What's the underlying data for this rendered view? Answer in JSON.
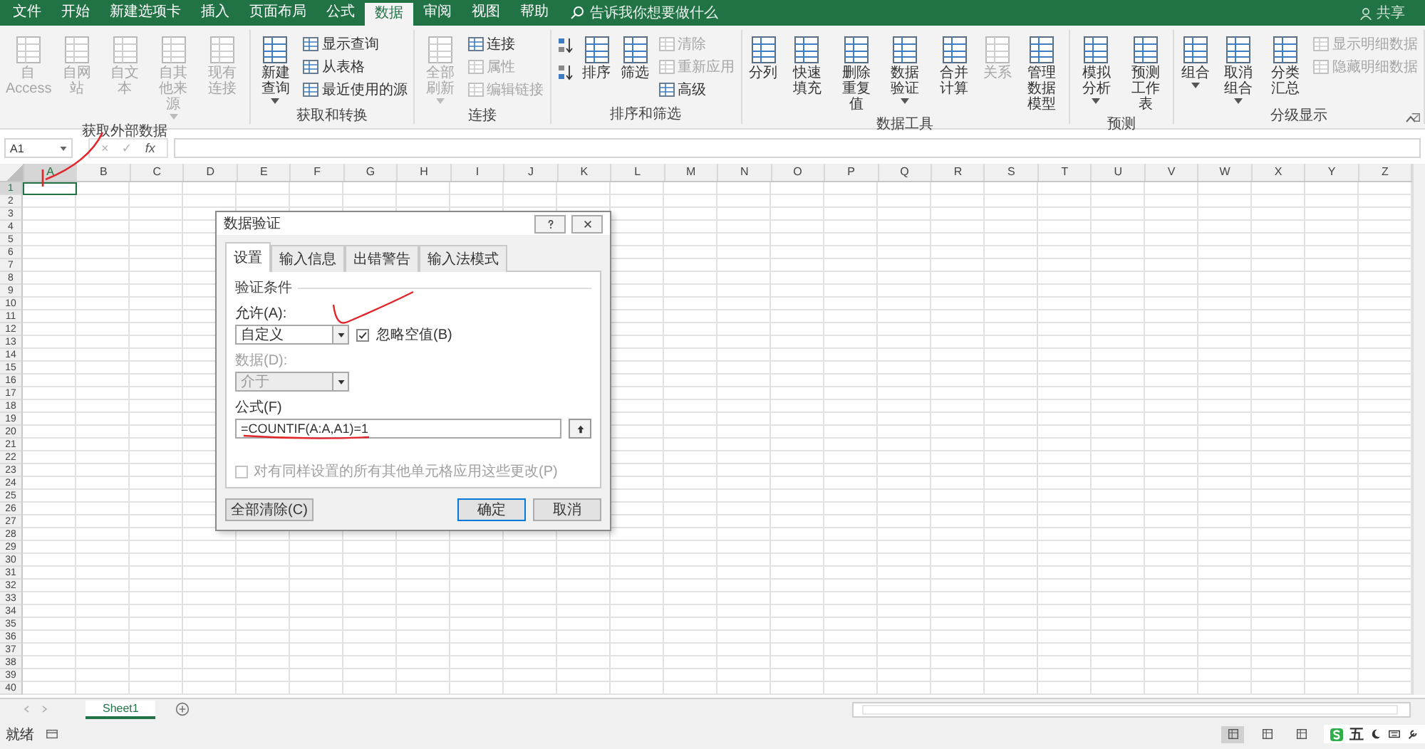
{
  "tabs": [
    {
      "label": "文件",
      "selected": false
    },
    {
      "label": "开始",
      "selected": false
    },
    {
      "label": "新建选项卡",
      "selected": false
    },
    {
      "label": "插入",
      "selected": false
    },
    {
      "label": "页面布局",
      "selected": false
    },
    {
      "label": "公式",
      "selected": false
    },
    {
      "label": "数据",
      "selected": true
    },
    {
      "label": "审阅",
      "selected": false
    },
    {
      "label": "视图",
      "selected": false
    },
    {
      "label": "帮助",
      "selected": false
    }
  ],
  "search": {
    "placeholder": "告诉我你想要做什么"
  },
  "share": "共享",
  "ribbon": [
    {
      "label": "获取外部数据",
      "launcher": false,
      "items": [
        {
          "kind": "large",
          "label": "自 Access",
          "disabled": true,
          "caret": false
        },
        {
          "kind": "large",
          "label": "自网站",
          "disabled": true,
          "caret": false
        },
        {
          "kind": "large",
          "label": "自文本",
          "disabled": true,
          "caret": false
        },
        {
          "kind": "large",
          "label": "自其他来源",
          "disabled": true,
          "caret": true
        },
        {
          "kind": "large",
          "label": "现有连接",
          "disabled": true,
          "caret": false
        }
      ]
    },
    {
      "label": "获取和转换",
      "launcher": false,
      "items": [
        {
          "kind": "large",
          "label": "新建查询",
          "disabled": false,
          "caret": true
        },
        {
          "kind": "small",
          "label": "显示查询",
          "disabled": false
        },
        {
          "kind": "small",
          "label": "从表格",
          "disabled": false
        },
        {
          "kind": "small",
          "label": "最近使用的源",
          "disabled": false
        }
      ]
    },
    {
      "label": "连接",
      "launcher": false,
      "items": [
        {
          "kind": "large",
          "label": "全部刷新",
          "disabled": true,
          "caret": true
        },
        {
          "kind": "small",
          "label": "连接",
          "disabled": false
        },
        {
          "kind": "small",
          "label": "属性",
          "disabled": true
        },
        {
          "kind": "small",
          "label": "编辑链接",
          "disabled": true
        }
      ]
    },
    {
      "label": "排序和筛选",
      "launcher": false,
      "items": [
        {
          "kind": "sort-asc",
          "disabled": false
        },
        {
          "kind": "sort-desc",
          "disabled": false
        },
        {
          "kind": "large",
          "label": "排序",
          "disabled": false,
          "caret": false
        },
        {
          "kind": "large",
          "label": "筛选",
          "disabled": false,
          "caret": false
        },
        {
          "kind": "small",
          "label": "清除",
          "disabled": true
        },
        {
          "kind": "small",
          "label": "重新应用",
          "disabled": true
        },
        {
          "kind": "small",
          "label": "高级",
          "disabled": false
        }
      ]
    },
    {
      "label": "数据工具",
      "launcher": false,
      "items": [
        {
          "kind": "large",
          "label": "分列",
          "disabled": false,
          "caret": false
        },
        {
          "kind": "large",
          "label": "快速填充",
          "disabled": false,
          "caret": false
        },
        {
          "kind": "large",
          "label": "删除重复值",
          "disabled": false,
          "caret": false
        },
        {
          "kind": "large",
          "label": "数据验证",
          "disabled": false,
          "caret": true
        },
        {
          "kind": "large",
          "label": "合并计算",
          "disabled": false,
          "caret": false
        },
        {
          "kind": "large",
          "label": "关系",
          "disabled": true,
          "caret": false
        },
        {
          "kind": "large",
          "label": "管理数据模型",
          "disabled": false,
          "caret": false
        }
      ]
    },
    {
      "label": "预测",
      "launcher": false,
      "items": [
        {
          "kind": "large",
          "label": "模拟分析",
          "disabled": false,
          "caret": true
        },
        {
          "kind": "large",
          "label": "预测工作表",
          "disabled": false,
          "caret": false
        }
      ]
    },
    {
      "label": "分级显示",
      "launcher": true,
      "items": [
        {
          "kind": "large",
          "label": "组合",
          "disabled": false,
          "caret": true
        },
        {
          "kind": "large",
          "label": "取消组合",
          "disabled": false,
          "caret": true
        },
        {
          "kind": "large",
          "label": "分类汇总",
          "disabled": false,
          "caret": false
        },
        {
          "kind": "small",
          "label": "显示明细数据",
          "disabled": true
        },
        {
          "kind": "small",
          "label": "隐藏明细数据",
          "disabled": true
        }
      ]
    }
  ],
  "formula_bar": {
    "name_box": "A1",
    "cancel": "×",
    "enter": "✓",
    "fx": "fx"
  },
  "columns": [
    {
      "label": "A",
      "selected": true
    },
    {
      "label": "B",
      "selected": false
    },
    {
      "label": "C",
      "selected": false
    },
    {
      "label": "D",
      "selected": false
    },
    {
      "label": "E",
      "selected": false
    },
    {
      "label": "F",
      "selected": false
    },
    {
      "label": "G",
      "selected": false
    },
    {
      "label": "H",
      "selected": false
    },
    {
      "label": "I",
      "selected": false
    },
    {
      "label": "J",
      "selected": false
    },
    {
      "label": "K",
      "selected": false
    },
    {
      "label": "L",
      "selected": false
    },
    {
      "label": "M",
      "selected": false
    },
    {
      "label": "N",
      "selected": false
    },
    {
      "label": "O",
      "selected": false
    },
    {
      "label": "P",
      "selected": false
    },
    {
      "label": "Q",
      "selected": false
    },
    {
      "label": "R",
      "selected": false
    },
    {
      "label": "S",
      "selected": false
    },
    {
      "label": "T",
      "selected": false
    },
    {
      "label": "U",
      "selected": false
    },
    {
      "label": "V",
      "selected": false
    },
    {
      "label": "W",
      "selected": false
    },
    {
      "label": "X",
      "selected": false
    },
    {
      "label": "Y",
      "selected": false
    },
    {
      "label": "Z",
      "selected": false
    }
  ],
  "rows": [
    {
      "label": "1",
      "selected": true
    },
    {
      "label": "2",
      "selected": false
    },
    {
      "label": "3",
      "selected": false
    },
    {
      "label": "4",
      "selected": false
    },
    {
      "label": "5",
      "selected": false
    },
    {
      "label": "6",
      "selected": false
    },
    {
      "label": "7",
      "selected": false
    },
    {
      "label": "8",
      "selected": false
    },
    {
      "label": "9",
      "selected": false
    },
    {
      "label": "10",
      "selected": false
    },
    {
      "label": "11",
      "selected": false
    },
    {
      "label": "12",
      "selected": false
    },
    {
      "label": "13",
      "selected": false
    },
    {
      "label": "14",
      "selected": false
    },
    {
      "label": "15",
      "selected": false
    },
    {
      "label": "16",
      "selected": false
    },
    {
      "label": "17",
      "selected": false
    },
    {
      "label": "18",
      "selected": false
    },
    {
      "label": "19",
      "selected": false
    },
    {
      "label": "20",
      "selected": false
    },
    {
      "label": "21",
      "selected": false
    },
    {
      "label": "22",
      "selected": false
    },
    {
      "label": "23",
      "selected": false
    },
    {
      "label": "24",
      "selected": false
    },
    {
      "label": "25",
      "selected": false
    },
    {
      "label": "26",
      "selected": false
    },
    {
      "label": "27",
      "selected": false
    },
    {
      "label": "28",
      "selected": false
    },
    {
      "label": "29",
      "selected": false
    },
    {
      "label": "30",
      "selected": false
    },
    {
      "label": "31",
      "selected": false
    },
    {
      "label": "32",
      "selected": false
    },
    {
      "label": "33",
      "selected": false
    },
    {
      "label": "34",
      "selected": false
    },
    {
      "label": "35",
      "selected": false
    },
    {
      "label": "36",
      "selected": false
    },
    {
      "label": "37",
      "selected": false
    },
    {
      "label": "38",
      "selected": false
    },
    {
      "label": "39",
      "selected": false
    },
    {
      "label": "40",
      "selected": false
    }
  ],
  "dialog": {
    "title": "数据验证",
    "tabs": [
      {
        "label": "设置",
        "selected": true
      },
      {
        "label": "输入信息",
        "selected": false
      },
      {
        "label": "出错警告",
        "selected": false
      },
      {
        "label": "输入法模式",
        "selected": false
      }
    ],
    "section": "验证条件",
    "allow": {
      "label": "允许(A):",
      "value": "自定义"
    },
    "ignore_blank": {
      "label": "忽略空值(B)",
      "checked": true
    },
    "data": {
      "label": "数据(D):",
      "value": "介于",
      "disabled": true
    },
    "formula": {
      "label": "公式(F)",
      "value": "=COUNTIF(A:A,A1)=1"
    },
    "apply_all": {
      "label": "对有同样设置的所有其他单元格应用这些更改(P)",
      "checked": false,
      "disabled": true
    },
    "buttons": [
      {
        "label": "全部清除(C)",
        "default": false
      },
      {
        "label": "确定",
        "default": true
      },
      {
        "label": "取消",
        "default": false
      }
    ]
  },
  "sheets": [
    {
      "label": "Sheet1",
      "selected": true
    }
  ],
  "status": {
    "text": "就绪",
    "views": [
      {
        "selected": true
      },
      {
        "selected": false
      },
      {
        "selected": false
      }
    ],
    "ime_mode": "五"
  }
}
